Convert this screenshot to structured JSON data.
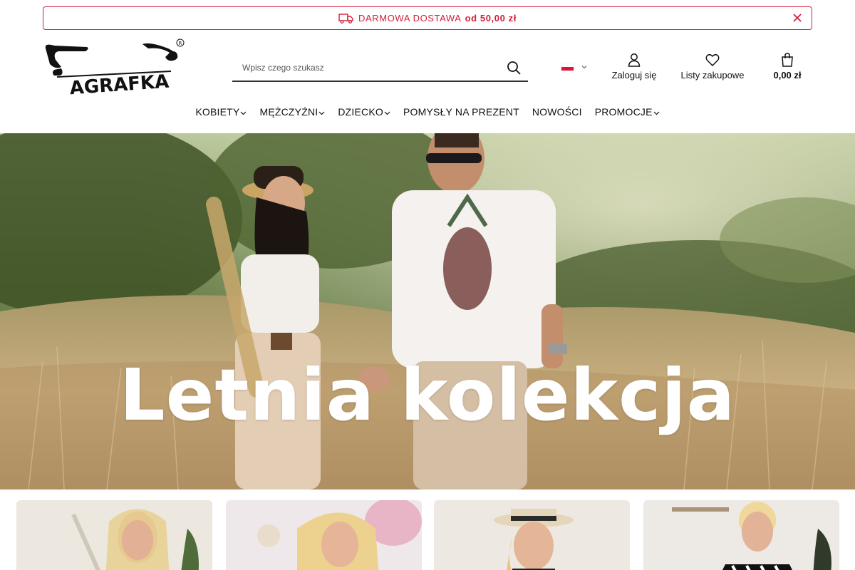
{
  "promo": {
    "text": "DARMOWA DOSTAWA",
    "amount": "od 50,00 zł",
    "color": "#d0203a"
  },
  "logo": {
    "text": "AGRAFKA"
  },
  "search": {
    "placeholder": "Wpisz czego szukasz"
  },
  "header": {
    "language": "pl",
    "login_label": "Zaloguj się",
    "wishlist_label": "Listy zakupowe",
    "cart_total": "0,00 zł"
  },
  "nav": {
    "items": [
      {
        "label": "KOBIETY",
        "dropdown": true
      },
      {
        "label": "MĘŻCZYŹNI",
        "dropdown": true
      },
      {
        "label": "DZIECKO",
        "dropdown": true
      },
      {
        "label": "POMYSŁY NA PREZENT",
        "dropdown": false
      },
      {
        "label": "NOWOŚCI",
        "dropdown": false
      },
      {
        "label": "PROMOCJE",
        "dropdown": true
      }
    ]
  },
  "hero": {
    "title": "Letnia kolekcja"
  }
}
